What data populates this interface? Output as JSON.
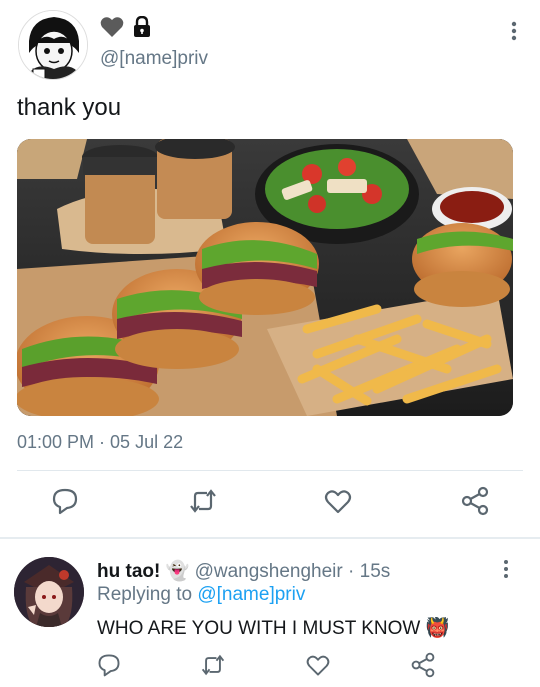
{
  "tweet": {
    "handle": "@[name]priv",
    "icons": [
      "heart-icon",
      "lock-icon"
    ],
    "text": "thank you",
    "media": "food-photo",
    "timestamp": "01:00 PM · 05 Jul 22",
    "actions": [
      "reply-icon",
      "retweet-icon",
      "like-icon",
      "share-icon"
    ]
  },
  "reply": {
    "name": "hu tao!",
    "name_emoji": "👻",
    "handle": "@wangshengheir",
    "time": "· 15s",
    "replying_prefix": "Replying to",
    "replying_to": "@[name]priv",
    "text": "WHO ARE YOU WITH I MUST KNOW",
    "text_emoji": "👹",
    "actions": [
      "reply-icon",
      "retweet-icon",
      "like-icon",
      "share-icon"
    ]
  },
  "colors": {
    "text_primary": "#14171a",
    "text_secondary": "#657786",
    "link": "#1da1f2",
    "divider": "#e1e8ed",
    "icon_gray": "#5b6770"
  }
}
